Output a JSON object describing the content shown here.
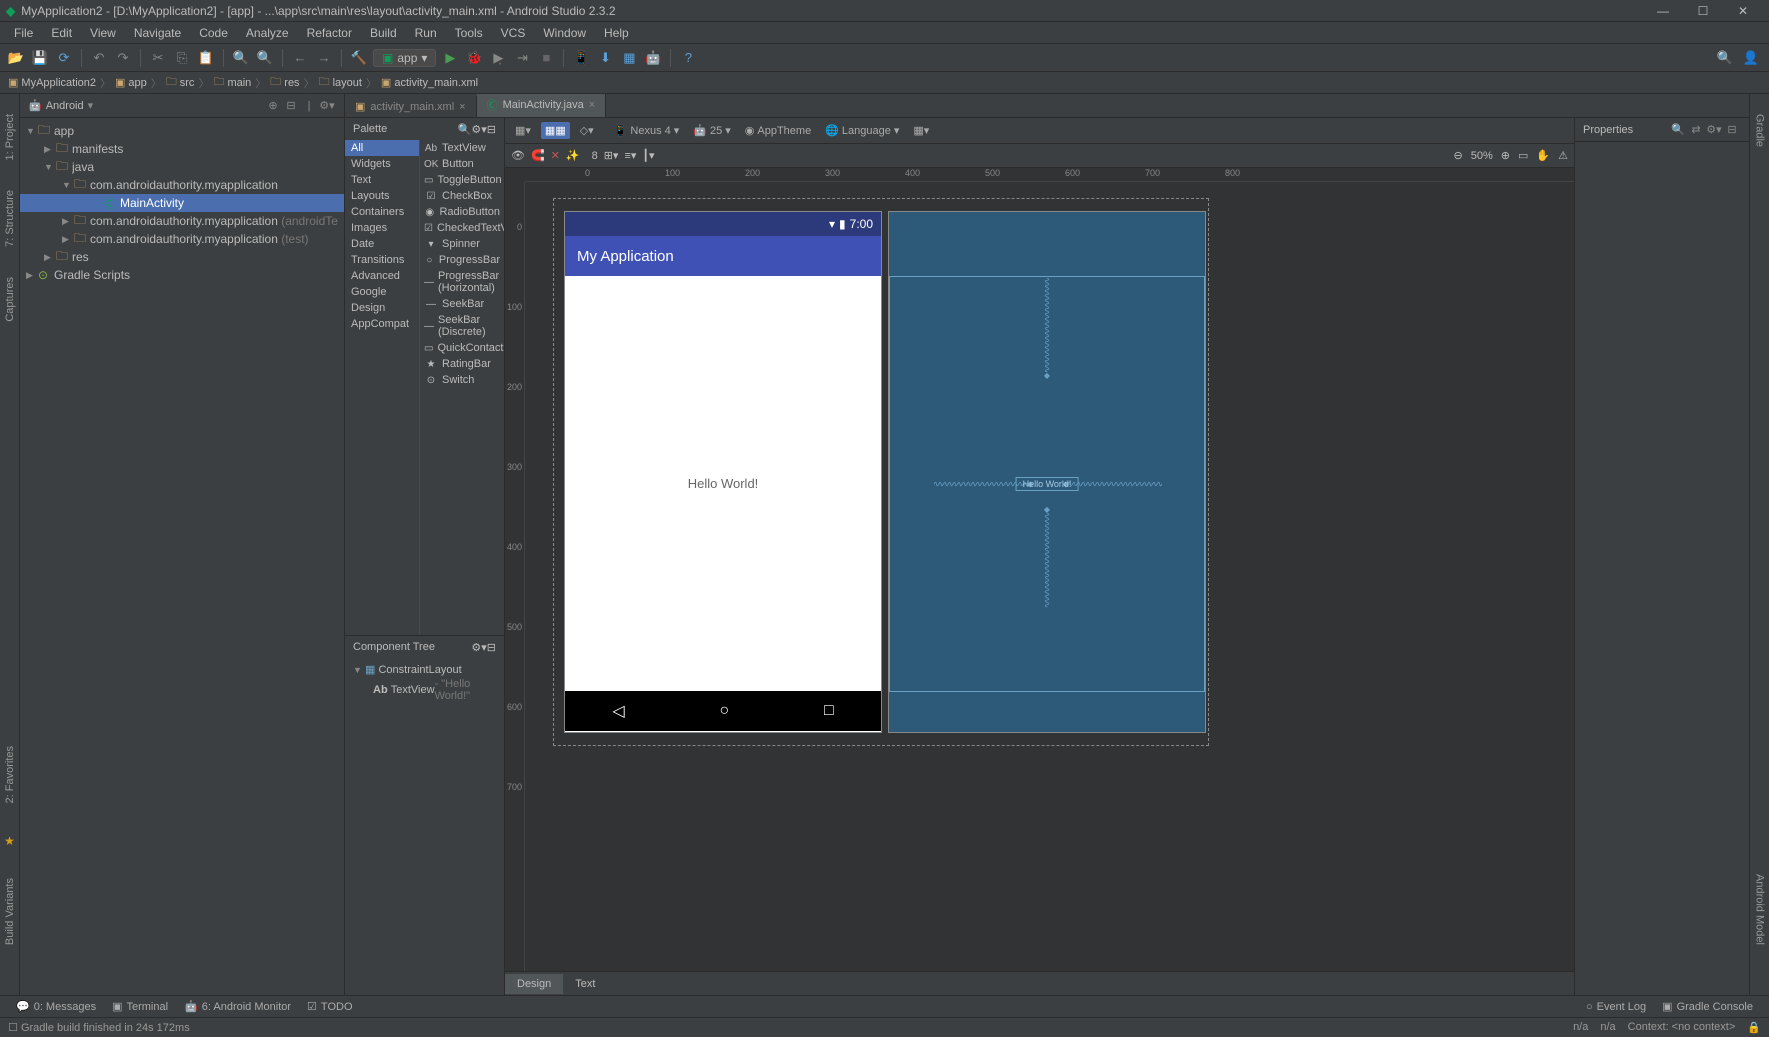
{
  "window": {
    "title": "MyApplication2 - [D:\\MyApplication2] - [app] - ...\\app\\src\\main\\res\\layout\\activity_main.xml - Android Studio 2.3.2"
  },
  "menu": {
    "file": "File",
    "edit": "Edit",
    "view": "View",
    "navigate": "Navigate",
    "code": "Code",
    "analyze": "Analyze",
    "refactor": "Refactor",
    "build": "Build",
    "run": "Run",
    "tools": "Tools",
    "vcs": "VCS",
    "window": "Window",
    "help": "Help"
  },
  "toolbar": {
    "run_config": "app"
  },
  "breadcrumb": [
    "MyApplication2",
    "app",
    "src",
    "main",
    "res",
    "layout",
    "activity_main.xml"
  ],
  "project": {
    "header": "Android",
    "tree": {
      "app": "app",
      "manifests": "manifests",
      "java": "java",
      "pkg1": "com.androidauthority.myapplication",
      "main_activity": "MainActivity",
      "pkg2": "com.androidauthority.myapplication",
      "pkg2_suffix": " (androidTest)",
      "pkg3": "com.androidauthority.myapplication",
      "pkg3_suffix": " (test)",
      "res": "res",
      "gradle": "Gradle Scripts"
    }
  },
  "left_tabs": {
    "project": "1: Project",
    "structure": "7: Structure",
    "captures": "Captures",
    "favorites": "2: Favorites",
    "build_variants": "Build Variants"
  },
  "right_tabs": {
    "gradle": "Gradle",
    "android_model": "Android Model"
  },
  "editor_tabs": {
    "tab1": "activity_main.xml",
    "tab2": "MainActivity.java"
  },
  "palette": {
    "title": "Palette",
    "categories": [
      "All",
      "Widgets",
      "Text",
      "Layouts",
      "Containers",
      "Images",
      "Date",
      "Transitions",
      "Advanced",
      "Google",
      "Design",
      "AppCompat"
    ],
    "items": [
      {
        "name": "TextView",
        "icon": "Ab"
      },
      {
        "name": "Button",
        "icon": "OK"
      },
      {
        "name": "ToggleButton",
        "icon": "▭"
      },
      {
        "name": "CheckBox",
        "icon": "☑"
      },
      {
        "name": "RadioButton",
        "icon": "◉"
      },
      {
        "name": "CheckedTextView",
        "icon": "☑"
      },
      {
        "name": "Spinner",
        "icon": "▾"
      },
      {
        "name": "ProgressBar",
        "icon": "○"
      },
      {
        "name": "ProgressBar (Horizontal)",
        "icon": "—"
      },
      {
        "name": "SeekBar",
        "icon": "—"
      },
      {
        "name": "SeekBar (Discrete)",
        "icon": "—"
      },
      {
        "name": "QuickContactBadge",
        "icon": "▭"
      },
      {
        "name": "RatingBar",
        "icon": "★"
      },
      {
        "name": "Switch",
        "icon": "⊙"
      }
    ]
  },
  "component_tree": {
    "title": "Component Tree",
    "root": "ConstraintLayout",
    "child": "TextView",
    "child_text": " - \"Hello World!\""
  },
  "designer": {
    "device": "Nexus 4",
    "api": "25",
    "theme": "AppTheme",
    "language": "Language",
    "zoom": "50%",
    "margin_default": "8",
    "status_time": "7:00",
    "app_title": "My Application",
    "hello_text": "Hello World!",
    "bp_hello": "Hello World!"
  },
  "properties": {
    "title": "Properties"
  },
  "bottom_tabs": {
    "design": "Design",
    "text": "Text"
  },
  "bottom_bar": {
    "messages": "0: Messages",
    "terminal": "Terminal",
    "android_monitor": "6: Android Monitor",
    "todo": "TODO",
    "event_log": "Event Log",
    "gradle_console": "Gradle Console"
  },
  "status": {
    "msg": "Gradle build finished in 24s 172ms",
    "na1": "n/a",
    "na2": "n/a",
    "context": "Context: <no context>"
  }
}
